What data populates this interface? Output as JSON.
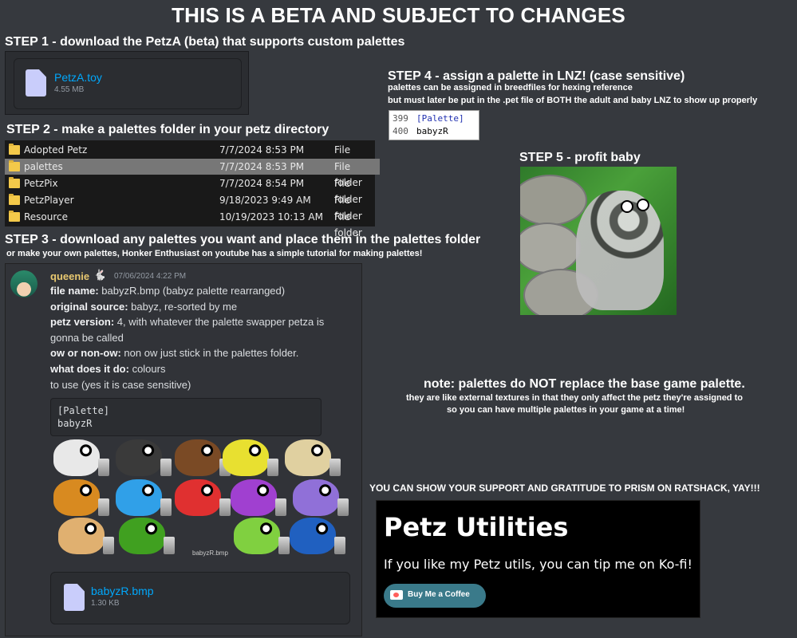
{
  "title": "THIS IS A BETA AND SUBJECT TO CHANGES",
  "step1": {
    "heading": "STEP 1 - download the PetzA (beta) that supports custom palettes",
    "file_name": "PetzA.toy",
    "file_size": "4.55 MB"
  },
  "step2": {
    "heading": "STEP 2 - make a palettes folder in your petz directory",
    "rows": [
      {
        "name": "Adopted Petz",
        "date": "7/7/2024 8:53 PM",
        "type": "File folder"
      },
      {
        "name": "palettes",
        "date": "7/7/2024 8:53 PM",
        "type": "File folder"
      },
      {
        "name": "PetzPix",
        "date": "7/7/2024 8:54 PM",
        "type": "File folder"
      },
      {
        "name": "PetzPlayer",
        "date": "9/18/2023 9:49 AM",
        "type": "File folder"
      },
      {
        "name": "Resource",
        "date": "10/19/2023 10:13 AM",
        "type": "File folder"
      }
    ],
    "selected_row": 1
  },
  "step3": {
    "heading": "STEP 3 - download any palettes you want and place them in the palettes folder",
    "sub": "or make your own palettes, Honker Enthusiast on youtube has a simple tutorial for making palettes!"
  },
  "step4": {
    "heading": "STEP 4 - assign a palette in LNZ! (case sensitive)",
    "line1": "palettes can be assigned in breedfiles for hexing reference",
    "line2": "but must later be put in the .pet file of BOTH the adult and baby LNZ to show up properly",
    "code": [
      {
        "num": "399",
        "text": "[Palette]"
      },
      {
        "num": "400",
        "text": "babyzR"
      }
    ]
  },
  "step5": {
    "heading": "STEP 5 - profit baby"
  },
  "message": {
    "username": "queenie",
    "badge": "🐇",
    "timestamp": "07/06/2024 4:22 PM",
    "lines": [
      {
        "label": "file name:",
        "text": " babyzR.bmp (babyz palette rearranged)"
      },
      {
        "label": "original source:",
        "text": " babyz, re-sorted by me"
      },
      {
        "label": "petz version:",
        "text": " 4, with whatever the palette swapper petza is"
      },
      {
        "label": "",
        "text": "gonna be called"
      },
      {
        "label": "ow or non-ow:",
        "text": " non ow just stick in the palettes folder."
      },
      {
        "label": "what does it do:",
        "text": " colours"
      },
      {
        "label": "",
        "text": "to use (yes it is case sensitive)"
      }
    ],
    "code_line1": "[Palette]",
    "code_line2": "babyzR",
    "image_caption": "babyzR.bmp",
    "attachment_name": "babyzR.bmp",
    "attachment_size": "1.30 KB",
    "puppy_colors": [
      "#e8e8e8",
      "#3a3a3a",
      "#7a4a25",
      "#e8e030",
      "#e0d0a0",
      "#d88a20",
      "#30a0e8",
      "#e03030",
      "#a040d0",
      "#9070d8",
      "#e0b070",
      "#40a020",
      "#80d040",
      "#2060c0"
    ]
  },
  "note": {
    "heading": "note: palettes do NOT replace the base game palette.",
    "line1": "they are like external textures in that they only affect the petz they're assigned to",
    "line2": "so you can have multiple palettes in your game at a time!"
  },
  "support": {
    "text": "YOU CAN SHOW YOUR SUPPORT AND GRATITUDE TO PRISM ON RATSHACK, YAY!!!",
    "kofi_title": "Petz Utilities",
    "kofi_body": "If you like my Petz utils, you can tip me on Ko-fi!",
    "kofi_button": "Buy Me a Coffee"
  }
}
